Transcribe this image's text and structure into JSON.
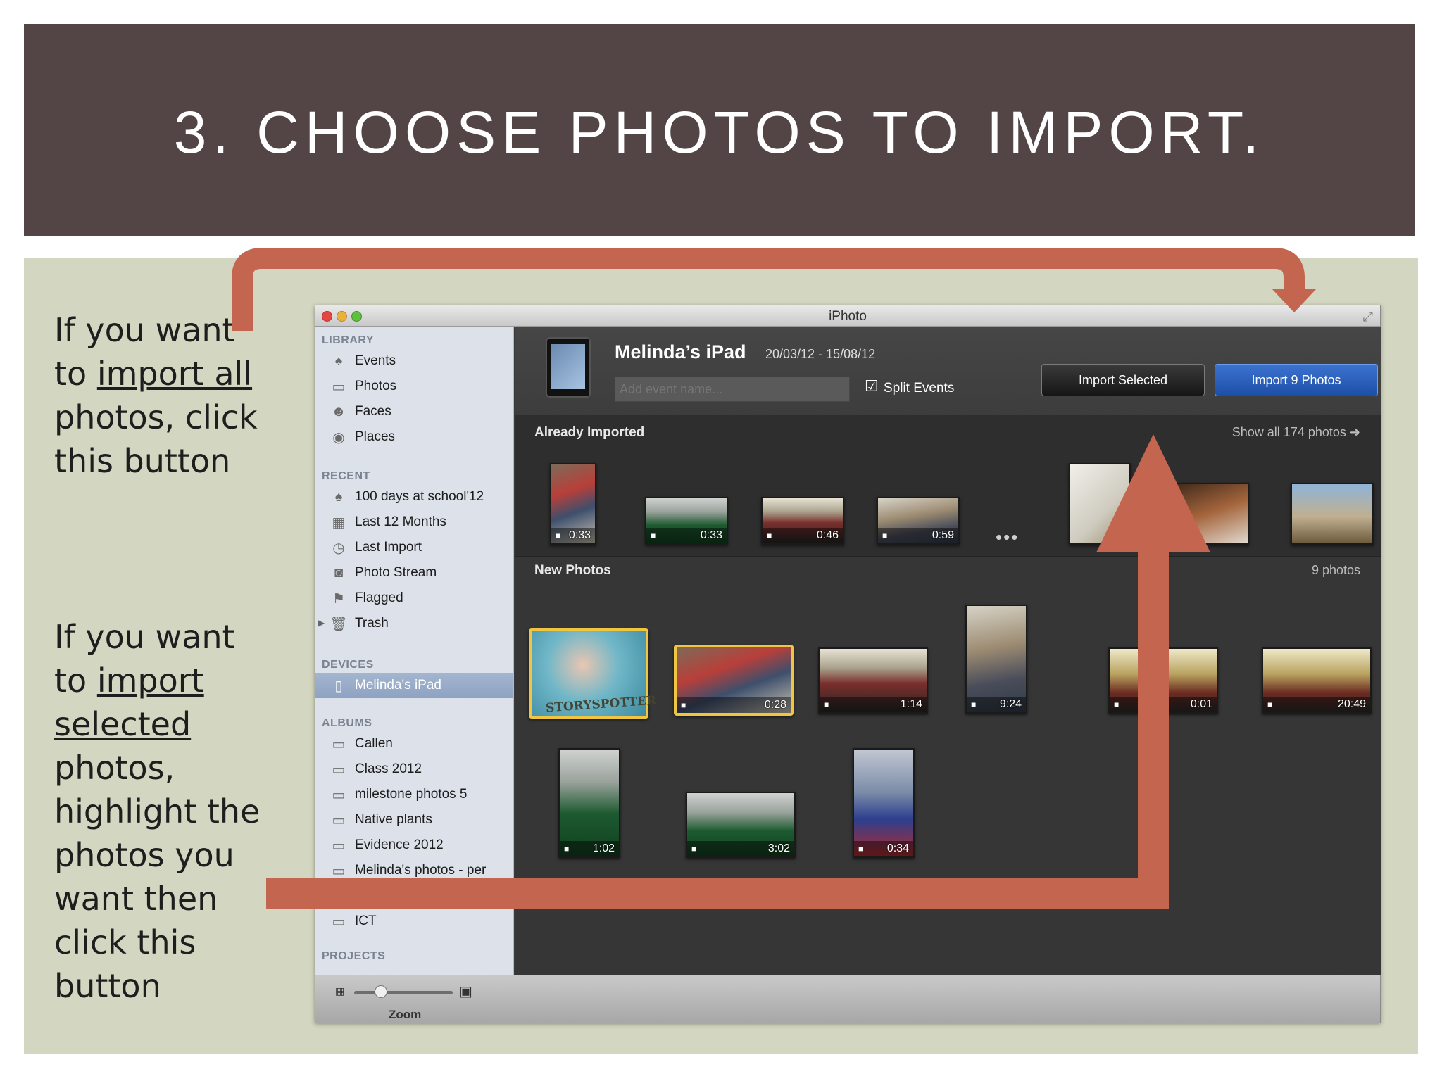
{
  "slide": {
    "title": "3.  CHOOSE PHOTOS TO IMPORT.",
    "instruction_1": {
      "line1": "If you want",
      "line2_prefix": "to ",
      "line2_link": "import all",
      "line3": "photos, click",
      "line4": "this button"
    },
    "instruction_2": {
      "line1": "If you want",
      "line2_prefix": "to ",
      "line2_link": "import",
      "line3_link": "selected",
      "line4": "photos,",
      "line5": "highlight the",
      "line6": "photos you",
      "line7": "want then",
      "line8": "click this",
      "line9": "button"
    },
    "colors": {
      "title_band": "#534546",
      "content_band": "#d3d6c0",
      "arrow": "#c4654f"
    }
  },
  "window": {
    "title": "iPhoto",
    "fullscreen_icon": "fullscreen-icon"
  },
  "sidebar": {
    "library_header": "LIBRARY",
    "library": [
      {
        "label": "Events",
        "icon": "palm-tree-icon"
      },
      {
        "label": "Photos",
        "icon": "photos-icon"
      },
      {
        "label": "Faces",
        "icon": "person-icon"
      },
      {
        "label": "Places",
        "icon": "globe-icon"
      }
    ],
    "recent_header": "RECENT",
    "recent": [
      {
        "label": "100 days at school'12",
        "icon": "palm-tree-icon"
      },
      {
        "label": "Last 12 Months",
        "icon": "calendar-icon"
      },
      {
        "label": "Last Import",
        "icon": "clock-icon"
      },
      {
        "label": "Photo Stream",
        "icon": "photo-stream-icon"
      },
      {
        "label": "Flagged",
        "icon": "flag-icon"
      },
      {
        "label": "Trash",
        "icon": "trash-icon"
      }
    ],
    "devices_header": "DEVICES",
    "devices": [
      {
        "label": "Melinda's iPad",
        "icon": "ipad-icon"
      }
    ],
    "albums_header": "ALBUMS",
    "albums": [
      {
        "label": "Callen"
      },
      {
        "label": "Class 2012"
      },
      {
        "label": "milestone photos 5"
      },
      {
        "label": "Native plants"
      },
      {
        "label": "Evidence 2012"
      },
      {
        "label": "Melinda's photos - per"
      },
      {
        "label": "ICT"
      }
    ],
    "projects_header": "PROJECTS"
  },
  "bottom": {
    "zoom_label": "Zoom"
  },
  "header": {
    "device_name": "Melinda’s iPad",
    "date_range": "20/03/12 - 15/08/12",
    "event_placeholder": "Add event name...",
    "split_events_label": "Split Events",
    "import_selected_label": "Import Selected",
    "import_all_label": "Import 9 Photos"
  },
  "already_imported": {
    "title": "Already Imported",
    "show_all": "Show all 174 photos",
    "more": "•••",
    "items": [
      {
        "duration": "0:33"
      },
      {
        "duration": "0:33"
      },
      {
        "duration": "0:46"
      },
      {
        "duration": "0:59"
      },
      {
        "duration": ""
      },
      {
        "duration": ""
      },
      {
        "duration": ""
      }
    ]
  },
  "new_photos": {
    "title": "New Photos",
    "count": "9 photos",
    "items": [
      {
        "duration": "",
        "selected": true,
        "label": "STORYSPOTTER"
      },
      {
        "duration": "0:28",
        "selected": true
      },
      {
        "duration": "1:14",
        "selected": false
      },
      {
        "duration": "9:24",
        "selected": false
      },
      {
        "duration": "0:01",
        "selected": false
      },
      {
        "duration": "20:49",
        "selected": false
      },
      {
        "duration": "1:02",
        "selected": false
      },
      {
        "duration": "3:02",
        "selected": false
      },
      {
        "duration": "0:34",
        "selected": false
      }
    ]
  }
}
